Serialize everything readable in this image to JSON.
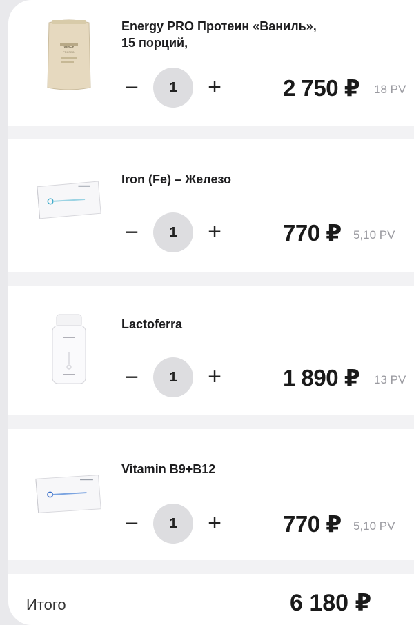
{
  "cart": {
    "items": [
      {
        "name_line1": "Energy PRO Протеин «Ваниль»,",
        "name_line2": "15 порций,",
        "minus": "−",
        "quantity": "1",
        "plus": "+",
        "price": "2 750 ₽",
        "pv": "18 PV",
        "image_label": "WHEY",
        "image_sublabel": "PROTEIN"
      },
      {
        "name_line1": "Iron (Fe) – Железо",
        "name_line2": "",
        "minus": "−",
        "quantity": "1",
        "plus": "+",
        "price": "770 ₽",
        "pv": "5,10 PV"
      },
      {
        "name_line1": "Lactoferra",
        "name_line2": "",
        "minus": "−",
        "quantity": "1",
        "plus": "+",
        "price": "1 890 ₽",
        "pv": "13 PV"
      },
      {
        "name_line1": "Vitamin B9+B12",
        "name_line2": "",
        "minus": "−",
        "quantity": "1",
        "plus": "+",
        "price": "770 ₽",
        "pv": "5,10 PV"
      }
    ],
    "total": {
      "label": "Итого",
      "value": "6 180 ₽"
    }
  },
  "colors": {
    "background": "#f2f2f4",
    "card": "#ffffff",
    "qty_circle": "#dddde0",
    "pv_text": "#9a9aa0"
  }
}
